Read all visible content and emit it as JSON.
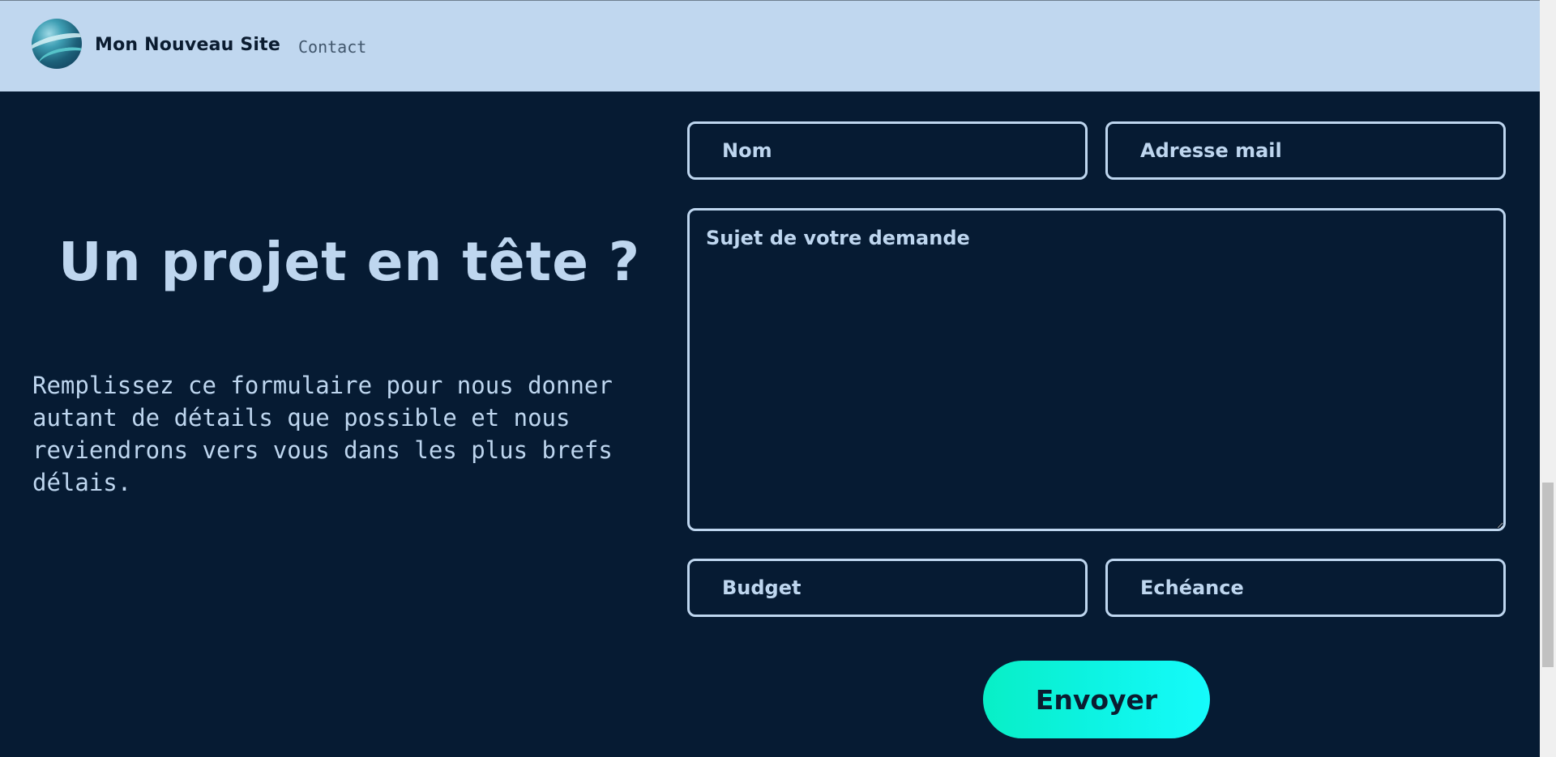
{
  "header": {
    "site_title": "Mon Nouveau Site",
    "nav_contact": "Contact"
  },
  "hero": {
    "headline": "Un projet en tête ?",
    "description": "Remplissez ce formulaire pour nous donner autant de détails que possible et nous reviendrons vers vous dans les plus brefs délais."
  },
  "form": {
    "name_placeholder": "Nom",
    "email_placeholder": "Adresse mail",
    "subject_placeholder": "Sujet de votre demande",
    "budget_placeholder": "Budget",
    "deadline_placeholder": "Echéance",
    "submit_label": "Envoyer"
  },
  "colors": {
    "header_bg": "#c0d7ef",
    "page_bg": "#061b33",
    "text_light": "#bed6ef",
    "accent": "#0df3e3"
  },
  "icons": {
    "logo": "globe-logo-icon"
  }
}
